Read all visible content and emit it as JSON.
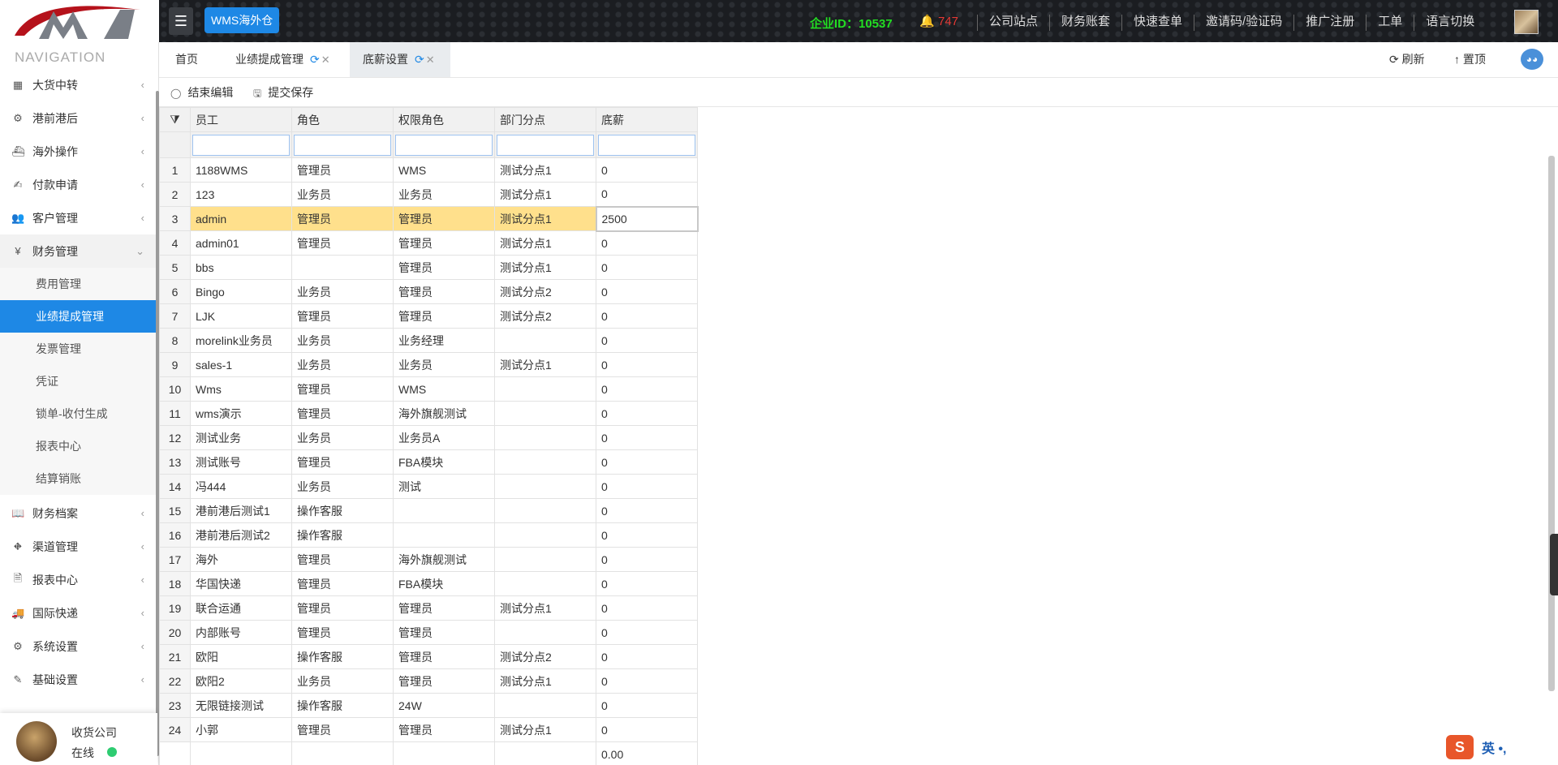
{
  "topbar": {
    "menu_icon": "menu-icon",
    "brand": "WMS海外仓",
    "enterprise_id": "企业ID：10537",
    "bell_count": "747",
    "links": [
      "公司站点",
      "财务账套",
      "快速查单",
      "邀请码/验证码",
      "推广注册",
      "工单",
      "语言切换"
    ],
    "colors": {
      "enterprise": "#22dd22",
      "bell_count": "#e53935",
      "brand_bg": "#1e88e5"
    }
  },
  "sidebar": {
    "title": "NAVIGATION",
    "items": [
      {
        "label": "大货中转",
        "icon": "grid-icon"
      },
      {
        "label": "港前港后",
        "icon": "cluster-icon"
      },
      {
        "label": "海外操作",
        "icon": "ship-icon"
      },
      {
        "label": "付款申请",
        "icon": "payment-icon"
      },
      {
        "label": "客户管理",
        "icon": "users-icon"
      },
      {
        "label": "财务管理",
        "icon": "yen-icon"
      },
      {
        "label": "财务档案",
        "icon": "book-icon"
      },
      {
        "label": "渠道管理",
        "icon": "road-icon"
      },
      {
        "label": "报表中心",
        "icon": "file-icon"
      },
      {
        "label": "国际快递",
        "icon": "truck-icon"
      },
      {
        "label": "系统设置",
        "icon": "gear-icon"
      },
      {
        "label": "基础设置",
        "icon": "edit-icon"
      }
    ],
    "subitems": [
      "费用管理",
      "业绩提成管理",
      "发票管理",
      "凭证",
      "锁单-收付生成",
      "报表中心",
      "结算销账"
    ],
    "active_subitem": "业绩提成管理",
    "user": {
      "name": "收货公司",
      "status": "在线"
    }
  },
  "tabs": {
    "items": [
      "首页",
      "业绩提成管理",
      "底薪设置"
    ],
    "refresh": "刷新",
    "top": "置顶"
  },
  "toolbar": {
    "end_edit": "结束编辑",
    "submit": "提交保存"
  },
  "grid": {
    "columns": [
      "员工",
      "角色",
      "权限角色",
      "部门分点",
      "底薪"
    ],
    "rows": [
      [
        "1188WMS",
        "管理员",
        "WMS",
        "测试分点1",
        "0"
      ],
      [
        "123",
        "业务员",
        "业务员",
        "测试分点1",
        "0"
      ],
      [
        "admin",
        "管理员",
        "管理员",
        "测试分点1",
        "2500"
      ],
      [
        "admin01",
        "管理员",
        "管理员",
        "测试分点1",
        "0"
      ],
      [
        "bbs",
        "",
        "管理员",
        "测试分点1",
        "0"
      ],
      [
        "Bingo",
        "业务员",
        "管理员",
        "测试分点2",
        "0"
      ],
      [
        "LJK",
        "管理员",
        "管理员",
        "测试分点2",
        "0"
      ],
      [
        "morelink业务员",
        "业务员",
        "业务经理",
        "",
        "0"
      ],
      [
        "sales-1",
        "业务员",
        "业务员",
        "测试分点1",
        "0"
      ],
      [
        "Wms",
        "管理员",
        "WMS",
        "",
        "0"
      ],
      [
        "wms演示",
        "管理员",
        "海外旗舰测试",
        "",
        "0"
      ],
      [
        "测试业务",
        "业务员",
        "业务员A",
        "",
        "0"
      ],
      [
        "测试账号",
        "管理员",
        "FBA模块",
        "",
        "0"
      ],
      [
        "冯444",
        "业务员",
        "测试",
        "",
        "0"
      ],
      [
        "港前港后测试1",
        "操作客服",
        "",
        "",
        "0"
      ],
      [
        "港前港后测试2",
        "操作客服",
        "",
        "",
        "0"
      ],
      [
        "海外",
        "管理员",
        "海外旗舰测试",
        "",
        "0"
      ],
      [
        "华国快递",
        "管理员",
        "FBA模块",
        "",
        "0"
      ],
      [
        "联合运通",
        "管理员",
        "管理员",
        "测试分点1",
        "0"
      ],
      [
        "内部账号",
        "管理员",
        "管理员",
        "",
        "0"
      ],
      [
        "欧阳",
        "操作客服",
        "管理员",
        "测试分点2",
        "0"
      ],
      [
        "欧阳2",
        "业务员",
        "管理员",
        "测试分点1",
        "0"
      ],
      [
        "无限链接测试",
        "操作客服",
        "24W",
        "",
        "0"
      ],
      [
        "小郭",
        "管理员",
        "管理员",
        "测试分点1",
        "0"
      ]
    ],
    "selected_row": 3,
    "total": "0.00"
  },
  "ime": {
    "logo": "S",
    "text": "英 •,"
  }
}
